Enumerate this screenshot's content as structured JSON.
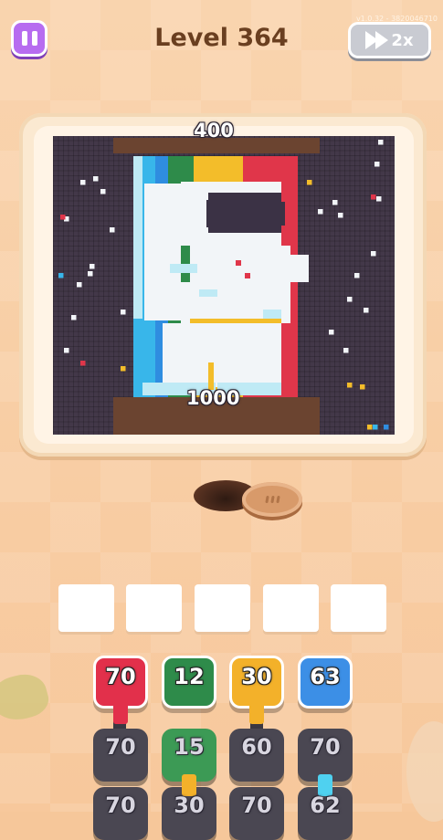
{
  "header": {
    "title": "Level 364",
    "version": "v1.0.32 - 3820046710",
    "speed_label": "2x",
    "icons": {
      "pause": "pause-icon",
      "speed": "fast-forward-icon"
    }
  },
  "board": {
    "top_count": "400",
    "bottom_count": "1000",
    "colors": {
      "background": "#433849",
      "brown": "#6b4430",
      "white": "#f2f5f8",
      "light_blue": "#bfeaf5",
      "cyan": "#38b6ea",
      "blue": "#2f8de0",
      "green": "#2e8b4a",
      "yellow": "#f3bd2a",
      "red": "#e0364a",
      "visor": "#3b3245"
    }
  },
  "slots": {
    "count": 5
  },
  "tiles": {
    "row1": [
      {
        "value": "70",
        "color": "#e2304b"
      },
      {
        "value": "12",
        "color": "#2e8b4a"
      },
      {
        "value": "30",
        "color": "#f3b12a"
      },
      {
        "value": "63",
        "color": "#3c8fe6"
      }
    ],
    "row2": [
      {
        "value": "70",
        "color": "#4a4752"
      },
      {
        "value": "15",
        "color": "#3c9a55"
      },
      {
        "value": "60",
        "color": "#4a4752"
      },
      {
        "value": "70",
        "color": "#4a4752"
      }
    ],
    "row3": [
      {
        "value": "70",
        "color": "#4a4752"
      },
      {
        "value": "30",
        "color": "#4a4752",
        "nozzle": "#f3b12a"
      },
      {
        "value": "70",
        "color": "#4a4752"
      },
      {
        "value": "62",
        "color": "#4a4752",
        "nozzle": "#4fd1f0"
      }
    ]
  }
}
